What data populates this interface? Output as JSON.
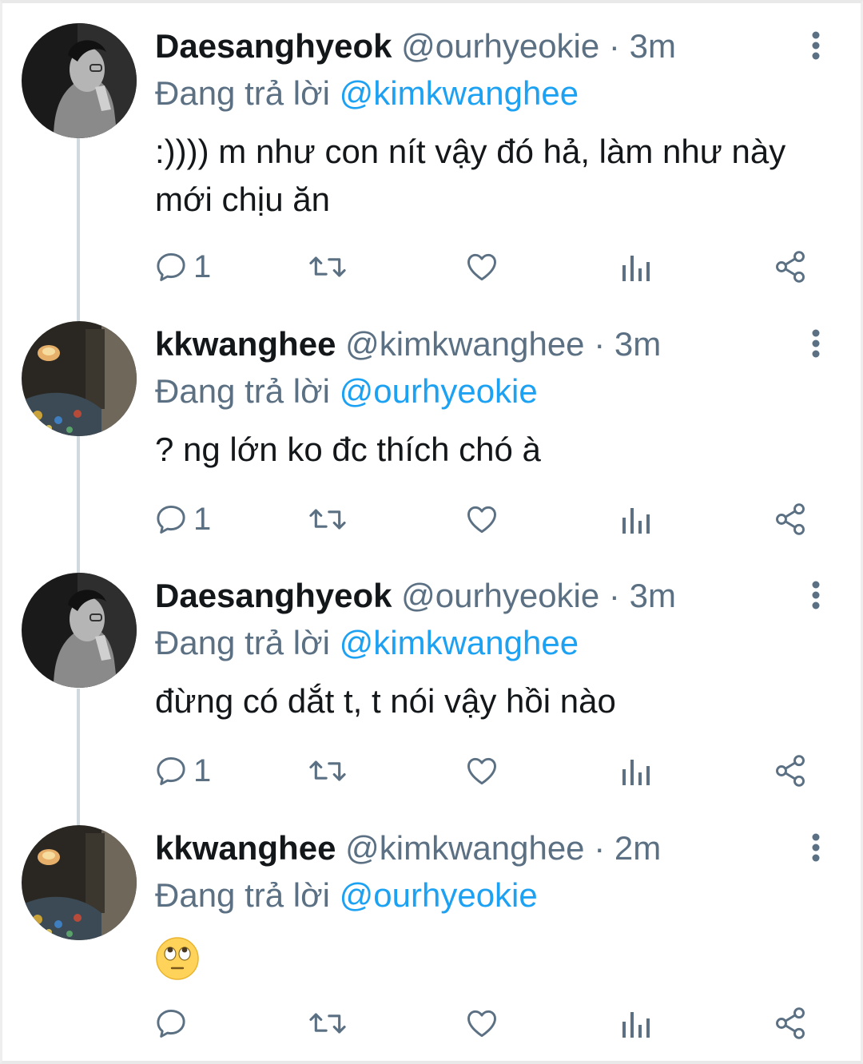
{
  "tweets": [
    {
      "name": "Daesanghyeok",
      "handle": "@ourhyeokie",
      "separator": "·",
      "time": "3m",
      "reply_label": "Đang trả lời",
      "reply_to": "@kimkwanghee",
      "text": ":)))) m như con nít vậy đó hả, làm như này mới chịu ăn",
      "reply_count": "1"
    },
    {
      "name": "kkwanghee",
      "handle": "@kimkwanghee",
      "separator": "·",
      "time": "3m",
      "reply_label": "Đang trả lời",
      "reply_to": "@ourhyeokie",
      "text": "? ng lớn ko đc thích chó à",
      "reply_count": "1"
    },
    {
      "name": "Daesanghyeok",
      "handle": "@ourhyeokie",
      "separator": "·",
      "time": "3m",
      "reply_label": "Đang trả lời",
      "reply_to": "@kimkwanghee",
      "text": "đừng có dắt t, t nói vậy hồi nào",
      "reply_count": "1"
    },
    {
      "name": "kkwanghee",
      "handle": "@kimkwanghee",
      "separator": "·",
      "time": "2m",
      "reply_label": "Đang trả lời",
      "reply_to": "@ourhyeokie",
      "emoji": "face-with-rolling-eyes",
      "reply_count": ""
    }
  ],
  "icons": [
    "reply-icon",
    "retweet-icon",
    "like-icon",
    "analytics-icon",
    "share-icon",
    "more-options-icon"
  ],
  "colors": {
    "text": "#14171a",
    "secondary": "#5b7083",
    "link": "#1da1f2",
    "thread_line": "#cfd9de"
  }
}
